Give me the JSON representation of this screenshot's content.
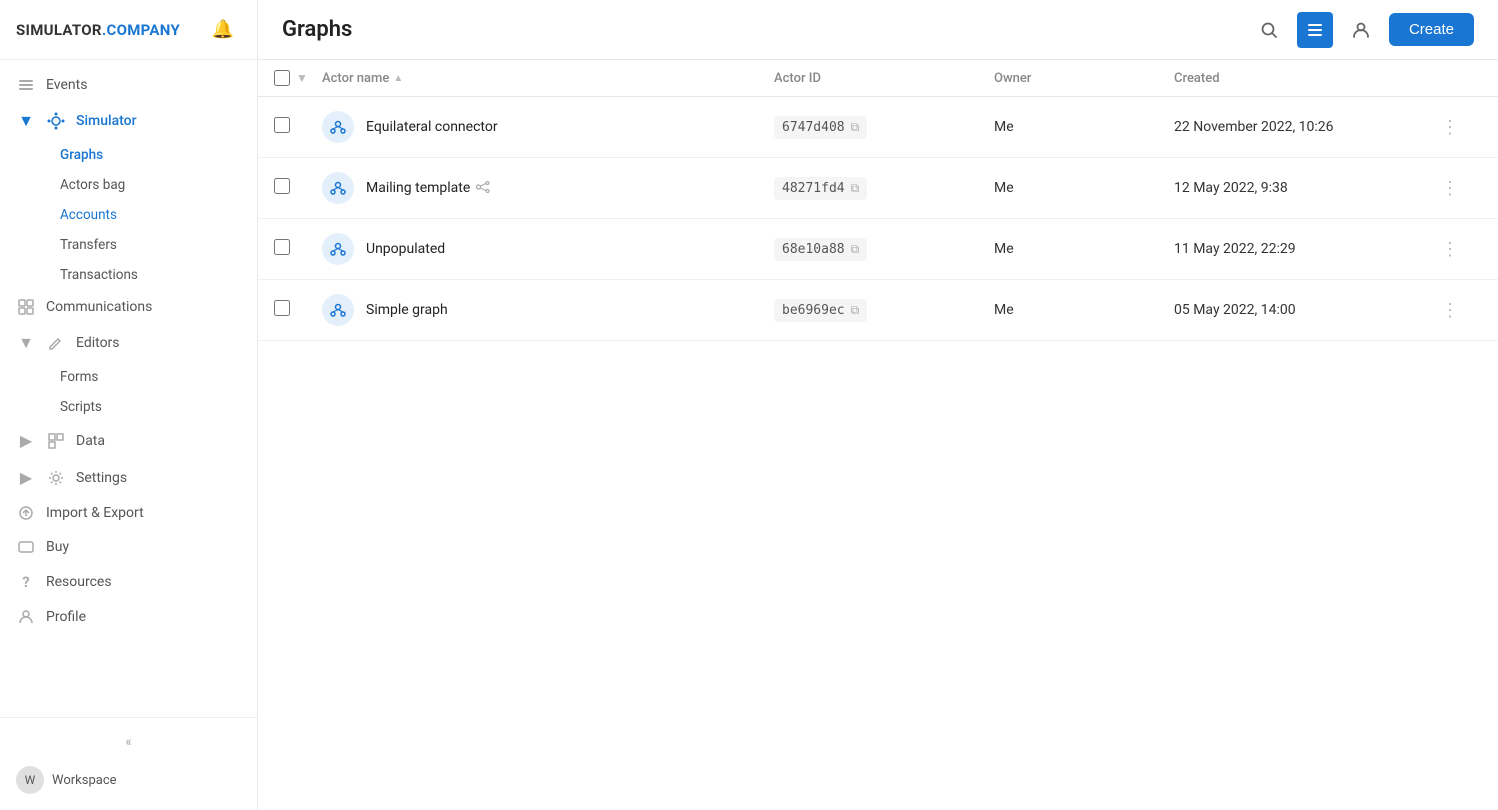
{
  "brand": {
    "name_part1": "SIMULATOR",
    "name_part2": ".COMPANY"
  },
  "header": {
    "title": "Graphs",
    "create_label": "Create"
  },
  "sidebar": {
    "nav_items": [
      {
        "id": "events",
        "label": "Events",
        "icon": "≡",
        "type": "item"
      },
      {
        "id": "simulator",
        "label": "Simulator",
        "icon": "◈",
        "type": "expandable",
        "expanded": true,
        "children": [
          {
            "id": "graphs",
            "label": "Graphs",
            "active": true
          },
          {
            "id": "actors-bag",
            "label": "Actors bag"
          },
          {
            "id": "accounts",
            "label": "Accounts"
          },
          {
            "id": "transfers",
            "label": "Transfers"
          },
          {
            "id": "transactions",
            "label": "Transactions"
          }
        ]
      },
      {
        "id": "communications",
        "label": "Communications",
        "icon": "⊞",
        "type": "item"
      },
      {
        "id": "editors",
        "label": "Editors",
        "icon": "✏",
        "type": "expandable",
        "expanded": true,
        "children": [
          {
            "id": "forms",
            "label": "Forms"
          },
          {
            "id": "scripts",
            "label": "Scripts"
          }
        ]
      },
      {
        "id": "data",
        "label": "Data",
        "icon": "▣",
        "type": "item"
      },
      {
        "id": "settings",
        "label": "Settings",
        "icon": "⚙",
        "type": "item"
      },
      {
        "id": "import-export",
        "label": "Import & Export",
        "icon": "↻",
        "type": "item"
      },
      {
        "id": "buy",
        "label": "Buy",
        "icon": "□",
        "type": "item"
      },
      {
        "id": "resources",
        "label": "Resources",
        "icon": "?",
        "type": "item"
      },
      {
        "id": "profile",
        "label": "Profile",
        "icon": "○",
        "type": "item"
      }
    ],
    "workspace_label": "Workspace",
    "collapse_icon": "«"
  },
  "table": {
    "columns": [
      {
        "id": "checkbox",
        "label": ""
      },
      {
        "id": "actor-name",
        "label": "Actor name",
        "sortable": true
      },
      {
        "id": "actor-id",
        "label": "Actor ID"
      },
      {
        "id": "owner",
        "label": "Owner"
      },
      {
        "id": "created",
        "label": "Created"
      },
      {
        "id": "actions",
        "label": ""
      }
    ],
    "rows": [
      {
        "id": 1,
        "name": "Equilateral connector",
        "actor_id": "6747d408",
        "owner": "Me",
        "created": "22 November 2022, 10:26",
        "shared": false
      },
      {
        "id": 2,
        "name": "Mailing template",
        "actor_id": "48271fd4",
        "owner": "Me",
        "created": "12 May 2022, 9:38",
        "shared": true
      },
      {
        "id": 3,
        "name": "Unpopulated",
        "actor_id": "68e10a88",
        "owner": "Me",
        "created": "11 May 2022, 22:29",
        "shared": false
      },
      {
        "id": 4,
        "name": "Simple graph",
        "actor_id": "be6969ec",
        "owner": "Me",
        "created": "05 May 2022, 14:00",
        "shared": false
      }
    ]
  }
}
